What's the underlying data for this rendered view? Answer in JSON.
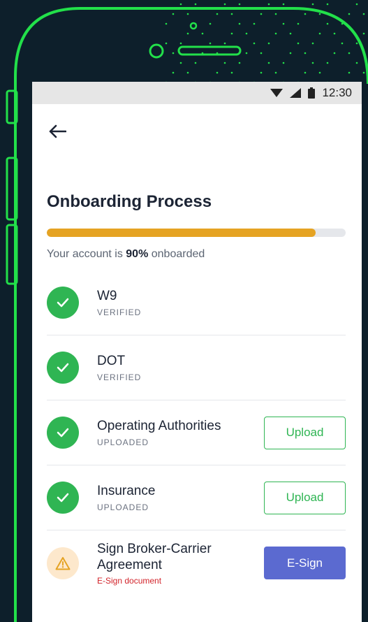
{
  "status_bar": {
    "time": "12:30"
  },
  "page": {
    "title": "Onboarding Process",
    "progress_prefix": "Your account is ",
    "progress_value": "90%",
    "progress_suffix": " onboarded",
    "progress_fraction": 0.9
  },
  "items": [
    {
      "name": "W9",
      "status": "VERIFIED",
      "state": "ok",
      "action": ""
    },
    {
      "name": "DOT",
      "status": "VERIFIED",
      "state": "ok",
      "action": ""
    },
    {
      "name": "Operating Authorities",
      "status": "UPLOADED",
      "state": "ok",
      "action": "Upload"
    },
    {
      "name": "Insurance",
      "status": "UPLOADED",
      "state": "ok",
      "action": "Upload"
    },
    {
      "name": "Sign Broker-Carrier Agreement",
      "status": "E-Sign document",
      "state": "warn",
      "action": "E-Sign"
    }
  ],
  "colors": {
    "accent_green": "#2fb553",
    "progress": "#e5a323",
    "primary_button": "#5b6ad0",
    "error_text": "#d2232a",
    "phone_outline": "#22e04a"
  },
  "icons": {
    "back": "arrow-left-icon",
    "ok": "check-icon",
    "warn": "warning-icon"
  }
}
